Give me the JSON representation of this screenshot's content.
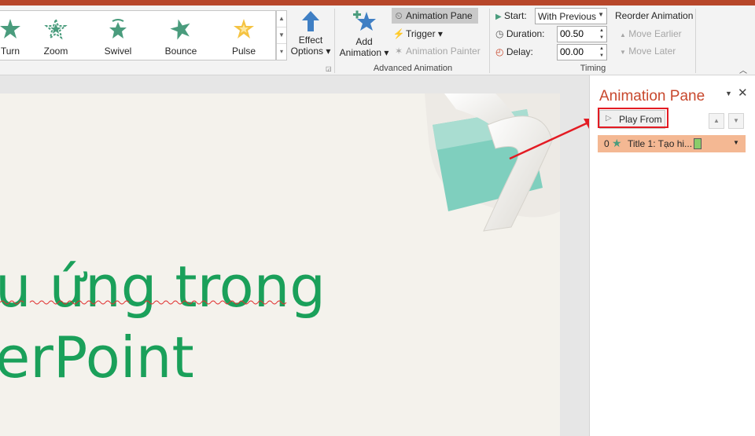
{
  "gallery": {
    "items": [
      {
        "label": "Turn",
        "icon": "turn-icon"
      },
      {
        "label": "Zoom",
        "icon": "zoom-icon"
      },
      {
        "label": "Swivel",
        "icon": "swivel-icon"
      },
      {
        "label": "Bounce",
        "icon": "bounce-icon"
      },
      {
        "label": "Pulse",
        "icon": "pulse-icon"
      }
    ]
  },
  "effect_options": {
    "line1": "Effect",
    "line2": "Options ▾"
  },
  "advanced": {
    "add_animation_line1": "Add",
    "add_animation_line2": "Animation ▾",
    "animation_pane": "Animation Pane",
    "trigger": "Trigger ▾",
    "animation_painter": "Animation Painter",
    "group_label": "Advanced Animation"
  },
  "timing": {
    "start_label": "Start:",
    "start_value": "With Previous",
    "duration_label": "Duration:",
    "duration_value": "00.50",
    "delay_label": "Delay:",
    "delay_value": "00.00",
    "reorder_label": "Reorder Animation",
    "move_earlier": "Move Earlier",
    "move_later": "Move Later",
    "group_label": "Timing"
  },
  "slide": {
    "line1": "u ứng trong",
    "line2": "erPoint"
  },
  "pane": {
    "title": "Animation Pane",
    "play_from": "Play From",
    "item": {
      "index": "0",
      "label": "Title 1: Tạo hi..."
    }
  },
  "colors": {
    "accent_red": "#c8482d",
    "highlight_box": "#e31b23",
    "slide_text": "#1aa05a",
    "selected_row": "#f4b893"
  }
}
